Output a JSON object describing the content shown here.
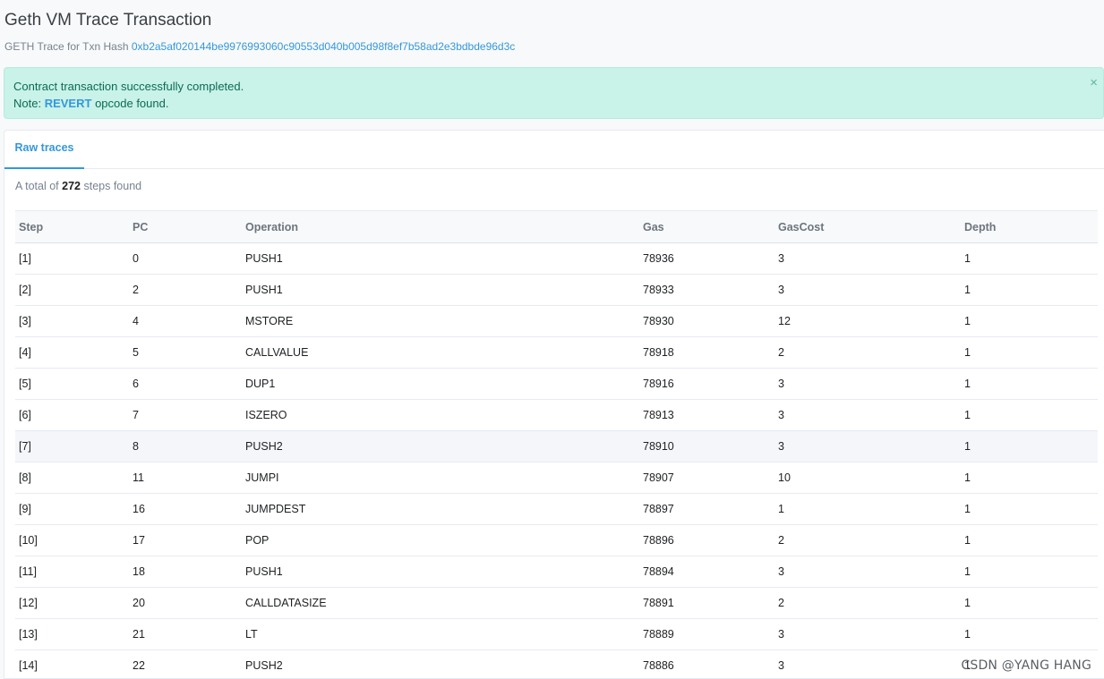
{
  "header": {
    "title": "Geth VM Trace Transaction",
    "subtitle_prefix": "GETH Trace for Txn Hash",
    "txn_hash": "0xb2a5af020144be9976993060c90553d040b005d98f8ef7b58ad2e3bdbde96d3c"
  },
  "alert": {
    "line1": "Contract transaction successfully completed.",
    "note_prefix": "Note:",
    "note_opcode": "REVERT",
    "note_suffix": "opcode found.",
    "close_label": "×"
  },
  "tabs": [
    {
      "label": "Raw traces",
      "active": true
    }
  ],
  "summary": {
    "prefix": "A total of",
    "count": "272",
    "suffix": "steps found"
  },
  "table": {
    "columns": [
      "Step",
      "PC",
      "Operation",
      "Gas",
      "GasCost",
      "Depth"
    ],
    "rows": [
      [
        "[1]",
        "0",
        "PUSH1",
        "78936",
        "3",
        "1"
      ],
      [
        "[2]",
        "2",
        "PUSH1",
        "78933",
        "3",
        "1"
      ],
      [
        "[3]",
        "4",
        "MSTORE",
        "78930",
        "12",
        "1"
      ],
      [
        "[4]",
        "5",
        "CALLVALUE",
        "78918",
        "2",
        "1"
      ],
      [
        "[5]",
        "6",
        "DUP1",
        "78916",
        "3",
        "1"
      ],
      [
        "[6]",
        "7",
        "ISZERO",
        "78913",
        "3",
        "1"
      ],
      [
        "[7]",
        "8",
        "PUSH2",
        "78910",
        "3",
        "1"
      ],
      [
        "[8]",
        "11",
        "JUMPI",
        "78907",
        "10",
        "1"
      ],
      [
        "[9]",
        "16",
        "JUMPDEST",
        "78897",
        "1",
        "1"
      ],
      [
        "[10]",
        "17",
        "POP",
        "78896",
        "2",
        "1"
      ],
      [
        "[11]",
        "18",
        "PUSH1",
        "78894",
        "3",
        "1"
      ],
      [
        "[12]",
        "20",
        "CALLDATASIZE",
        "78891",
        "2",
        "1"
      ],
      [
        "[13]",
        "21",
        "LT",
        "78889",
        "3",
        "1"
      ],
      [
        "[14]",
        "22",
        "PUSH2",
        "78886",
        "3",
        "1"
      ]
    ],
    "hovered_row": 6
  },
  "watermark": "CSDN @YANG HANG",
  "colors": {
    "accent": "#3498db",
    "alert_bg": "#c9f2e8",
    "alert_text": "#0b6b55"
  }
}
